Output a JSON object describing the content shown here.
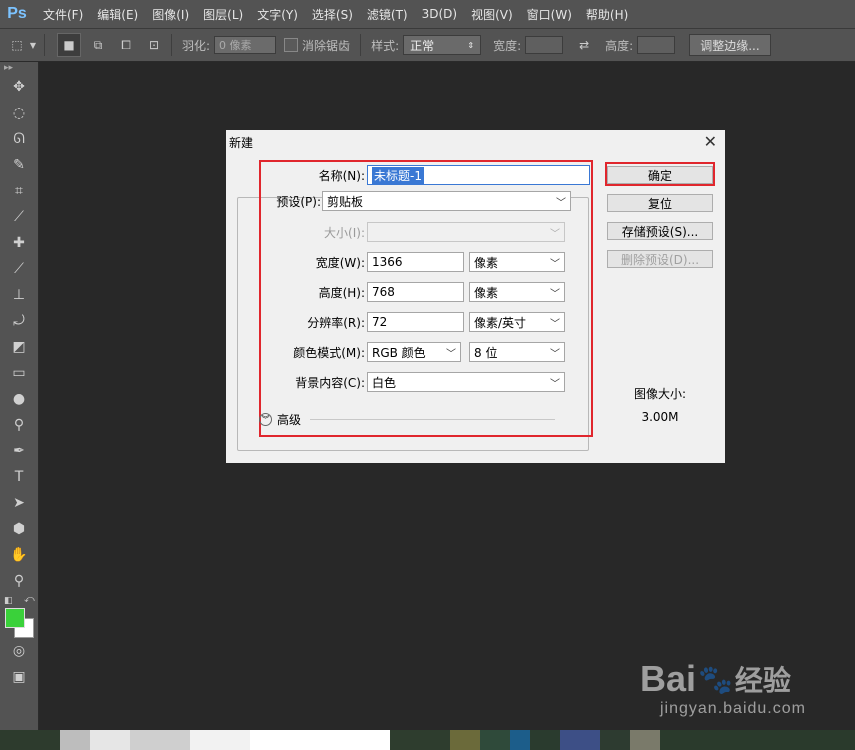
{
  "app": {
    "logo": "Ps"
  },
  "menu": [
    "文件(F)",
    "编辑(E)",
    "图像(I)",
    "图层(L)",
    "文字(Y)",
    "选择(S)",
    "滤镜(T)",
    "3D(D)",
    "视图(V)",
    "窗口(W)",
    "帮助(H)"
  ],
  "options": {
    "feather_label": "羽化:",
    "feather_value": "0 像素",
    "antialias_label": "消除锯齿",
    "style_label": "样式:",
    "style_value": "正常",
    "width_label": "宽度:",
    "height_label": "高度:",
    "refine_button": "调整边缘..."
  },
  "dialog": {
    "title": "新建",
    "name_label": "名称(N):",
    "name_value": "未标题-1",
    "preset_label": "预设(P):",
    "preset_value": "剪贴板",
    "size_label": "大小(I):",
    "width_label": "宽度(W):",
    "width_value": "1366",
    "width_unit": "像素",
    "height_label": "高度(H):",
    "height_value": "768",
    "height_unit": "像素",
    "resolution_label": "分辨率(R):",
    "resolution_value": "72",
    "resolution_unit": "像素/英寸",
    "color_mode_label": "颜色模式(M):",
    "color_mode_value": "RGB 颜色",
    "bit_depth_value": "8 位",
    "background_label": "背景内容(C):",
    "background_value": "白色",
    "advanced_label": "高级",
    "ok_button": "确定",
    "reset_button": "复位",
    "save_preset_button": "存储预设(S)...",
    "delete_preset_button": "删除预设(D)...",
    "image_size_label": "图像大小:",
    "image_size_value": "3.00M"
  },
  "watermark": {
    "logo_left": "Bai",
    "logo_right": "经验",
    "sub": "jingyan.baidu.com"
  },
  "colors": {
    "foreground": "#3ad13a",
    "background": "#ffffff",
    "highlight": "#e0262d"
  }
}
